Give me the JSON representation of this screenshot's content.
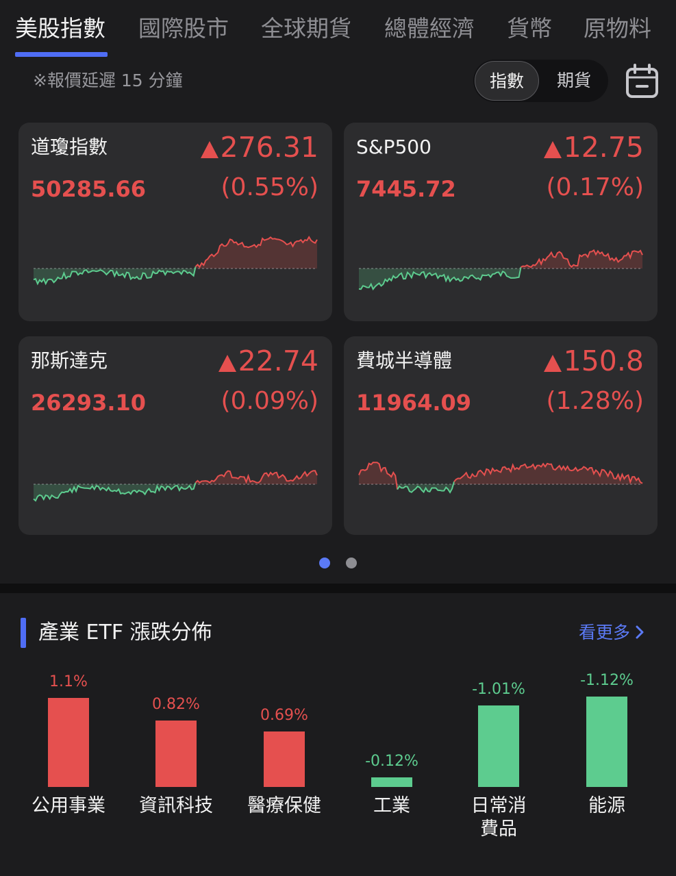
{
  "tabs": [
    {
      "label": "美股指數",
      "active": true
    },
    {
      "label": "國際股市",
      "active": false
    },
    {
      "label": "全球期貨",
      "active": false
    },
    {
      "label": "總體經濟",
      "active": false
    },
    {
      "label": "貨幣",
      "active": false
    },
    {
      "label": "原物料",
      "active": false
    }
  ],
  "delay_note": "※報價延遲 15 分鐘",
  "segment": {
    "index_label": "指數",
    "futures_label": "期貨",
    "selected": "指數"
  },
  "icons": {
    "calendar": "calendar-icon",
    "up_triangle": "up-triangle-icon",
    "chevron": "chevron-right-icon"
  },
  "colors": {
    "up": "#e5504f",
    "down": "#5dcc8f",
    "accent": "#4f6df5",
    "link": "#5b7af6"
  },
  "cards": [
    {
      "name": "道瓊指數",
      "change": "276.31",
      "price": "50285.66",
      "percent": "(0.55%)"
    },
    {
      "name": "S&P500",
      "change": "12.75",
      "price": "7445.72",
      "percent": "(0.17%)"
    },
    {
      "name": "那斯達克",
      "change": "22.74",
      "price": "26293.10",
      "percent": "(0.09%)"
    },
    {
      "name": "費城半導體",
      "change": "150.8",
      "price": "11964.09",
      "percent": "(1.28%)"
    }
  ],
  "pager": {
    "total": 2,
    "current": 1
  },
  "etf": {
    "title": "產業 ETF 漲跌分佈",
    "more_label": "看更多",
    "chart_data": {
      "type": "bar",
      "categories": [
        "公用事業",
        "資訊科技",
        "醫療保健",
        "工業",
        "日常消費品",
        "能源"
      ],
      "values": [
        1.1,
        0.82,
        0.69,
        -0.12,
        -1.01,
        -1.12
      ],
      "value_labels": [
        "1.1%",
        "0.82%",
        "0.69%",
        "-0.12%",
        "-1.01%",
        "-1.12%"
      ],
      "category_lines": [
        [
          "公用事業"
        ],
        [
          "資訊科技"
        ],
        [
          "醫療保健"
        ],
        [
          "工業"
        ],
        [
          "日常消",
          "費品"
        ],
        [
          "能源"
        ]
      ]
    }
  }
}
